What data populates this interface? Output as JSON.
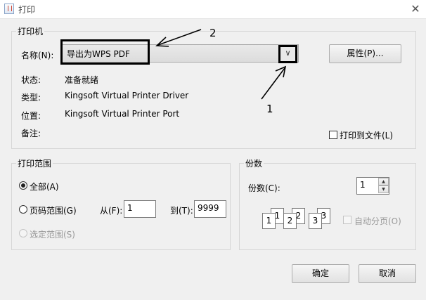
{
  "window": {
    "title": "打印",
    "close_glyph": "✕"
  },
  "printer": {
    "legend": "打印机",
    "name_label": "名称(N):",
    "name_value": "导出为WPS PDF",
    "properties_button": "属性(P)...",
    "status_label": "状态:",
    "status_value": "准备就绪",
    "type_label": "类型:",
    "type_value": "Kingsoft Virtual Printer Driver",
    "location_label": "位置:",
    "location_value": "Kingsoft Virtual Printer Port",
    "comment_label": "备注:",
    "print_to_file_label": "打印到文件(L)"
  },
  "range": {
    "legend": "打印范围",
    "all_label": "全部(A)",
    "pages_label": "页码范围(G)",
    "from_label": "从(F):",
    "from_value": "1",
    "to_label": "到(T):",
    "to_value": "9999",
    "selection_label": "选定范围(S)"
  },
  "copies": {
    "legend": "份数",
    "count_label": "份数(C):",
    "count_value": "1",
    "collate_label": "自动分页(O)",
    "collate_pages": [
      "1",
      "1",
      "2",
      "2",
      "3",
      "3"
    ]
  },
  "buttons": {
    "ok": "确定",
    "cancel": "取消"
  },
  "annotations": {
    "label_1": "1",
    "label_2": "2"
  }
}
